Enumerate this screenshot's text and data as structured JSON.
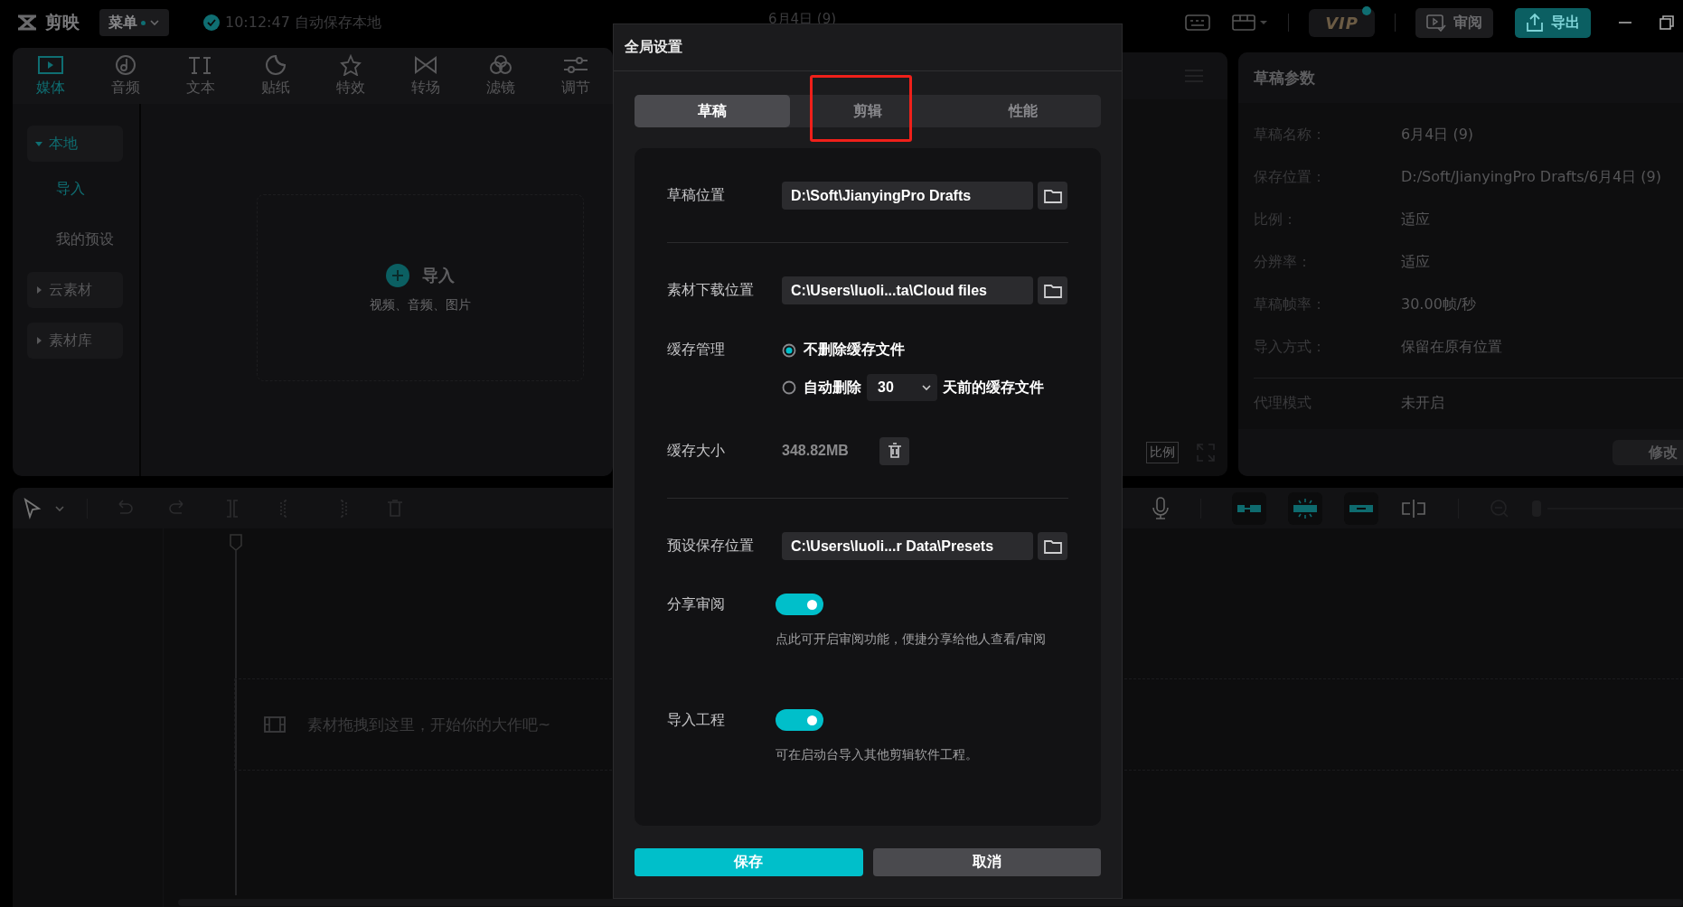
{
  "top_bar": {
    "app_name": "剪映",
    "menu": "菜单",
    "autosave": "10:12:47 自动保存本地",
    "project_title": "6月4日 (9)",
    "vip": "VIP",
    "review": "审阅",
    "export": "导出"
  },
  "media_tabs": [
    {
      "label": "媒体",
      "selected": true
    },
    {
      "label": "音频",
      "selected": false
    },
    {
      "label": "文本",
      "selected": false
    },
    {
      "label": "贴纸",
      "selected": false
    },
    {
      "label": "特效",
      "selected": false
    },
    {
      "label": "转场",
      "selected": false
    },
    {
      "label": "滤镜",
      "selected": false
    },
    {
      "label": "调节",
      "selected": false
    }
  ],
  "media_sidebar": [
    {
      "label": "本地",
      "expanded": true,
      "selected": true,
      "children": [
        {
          "label": "导入",
          "selected": true
        },
        {
          "label": "我的预设",
          "selected": false
        }
      ]
    },
    {
      "label": "云素材",
      "expanded": false,
      "selected": false
    },
    {
      "label": "素材库",
      "expanded": false,
      "selected": false
    }
  ],
  "import_zone": {
    "label": "导入",
    "hint": "视频、音频、图片"
  },
  "player": {
    "ratio": "比例"
  },
  "draft_params": {
    "title": "草稿参数",
    "rows": [
      {
        "label": "草稿名称：",
        "value": "6月4日 (9)"
      },
      {
        "label": "保存位置：",
        "value": "D:/Soft/JianyingPro Drafts/6月4日 (9)"
      },
      {
        "label": "比例：",
        "value": "适应"
      },
      {
        "label": "分辨率：",
        "value": "适应"
      },
      {
        "label": "草稿帧率：",
        "value": "30.00帧/秒"
      },
      {
        "label": "导入方式：",
        "value": "保留在原有位置"
      },
      {
        "label": "代理模式",
        "value": "未开启"
      }
    ],
    "button": "修改"
  },
  "timeline": {
    "empty_hint": "素材拖拽到这里，开始你的大作吧~"
  },
  "dialog": {
    "title": "全局设置",
    "tabs": [
      {
        "label": "草稿",
        "selected": true,
        "highlighted": false
      },
      {
        "label": "剪辑",
        "selected": false,
        "highlighted": true
      },
      {
        "label": "性能",
        "selected": false,
        "highlighted": false
      }
    ],
    "rows": [
      {
        "kind": "path",
        "label": "草稿位置",
        "value": "D:\\Soft\\JianyingPro Drafts"
      },
      {
        "kind": "divider"
      },
      {
        "kind": "path",
        "label": "素材下载位置",
        "value": "C:\\Users\\luoli...ta\\Cloud files"
      },
      {
        "kind": "radio",
        "label": "缓存管理",
        "options": [
          {
            "label": "不删除缓存文件",
            "selected": true
          },
          {
            "label": "自动删除",
            "selected": false,
            "select_value": "30",
            "suffix": "天前的缓存文件"
          }
        ]
      },
      {
        "kind": "size",
        "label": "缓存大小",
        "value": "348.82MB"
      },
      {
        "kind": "divider"
      },
      {
        "kind": "path",
        "label": "预设保存位置",
        "value": "C:\\Users\\luoli...r Data\\Presets"
      },
      {
        "kind": "toggle",
        "label": "分享审阅",
        "on": true,
        "description": "点此可开启审阅功能，便捷分享给他人查看/审阅"
      },
      {
        "kind": "toggle",
        "label": "导入工程",
        "on": true,
        "description": "可在启动台导入其他剪辑软件工程。"
      }
    ],
    "buttons": [
      {
        "kind": "primary",
        "label": "保存"
      },
      {
        "kind": "secondary",
        "label": "取消"
      }
    ]
  }
}
